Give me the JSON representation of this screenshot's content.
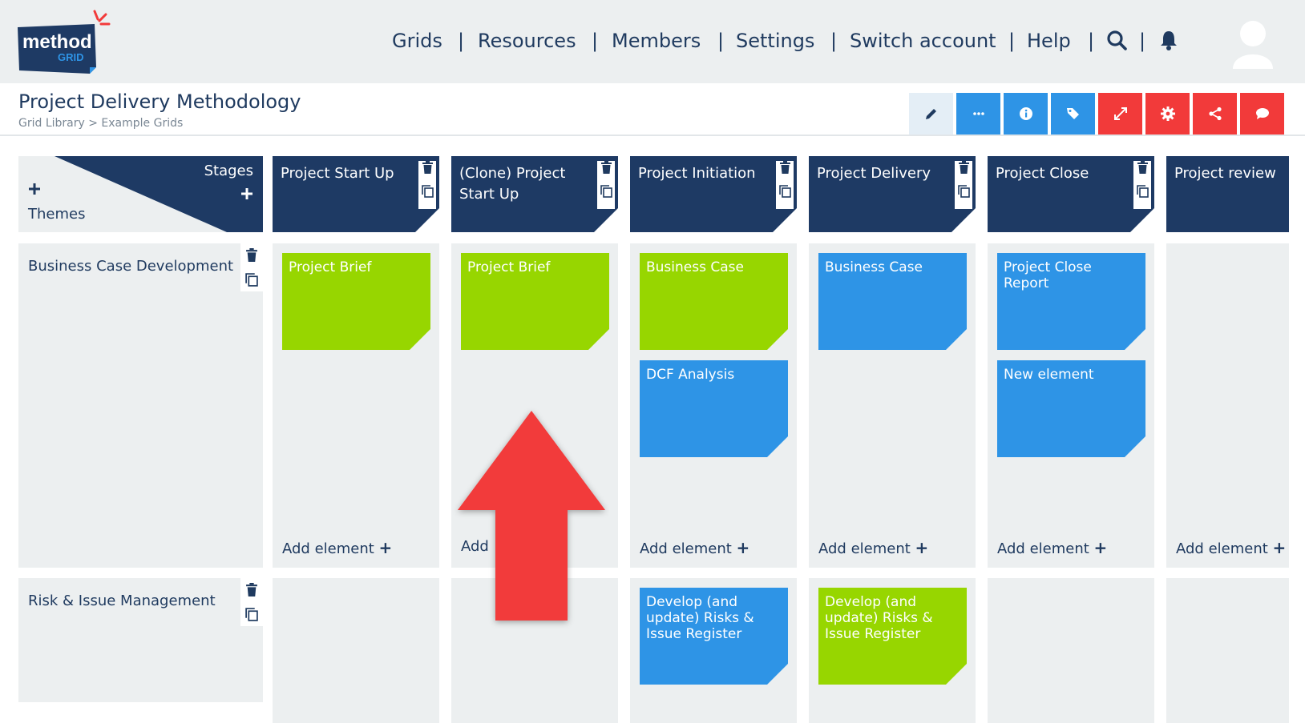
{
  "logo": {
    "word": "method",
    "sub": "GRID"
  },
  "nav": {
    "items": [
      "Grids",
      "Resources",
      "Members",
      "Settings",
      "Switch account",
      "Help"
    ],
    "separator": "|"
  },
  "header": {
    "title": "Project Delivery Methodology",
    "breadcrumb": "Grid Library > Example Grids"
  },
  "toolbar": {
    "buttons": [
      {
        "icon": "pencil-icon",
        "color": "#e4eef6"
      },
      {
        "icon": "more-icon",
        "color": "#2e94e6"
      },
      {
        "icon": "info-icon",
        "color": "#2e94e6"
      },
      {
        "icon": "tag-icon",
        "color": "#2e94e6"
      },
      {
        "icon": "expand-icon",
        "color": "#f23a3a"
      },
      {
        "icon": "gear-icon",
        "color": "#f23a3a"
      },
      {
        "icon": "share-icon",
        "color": "#f23a3a"
      },
      {
        "icon": "comment-icon",
        "color": "#f23a3a"
      }
    ]
  },
  "grid": {
    "corner": {
      "stages": "Stages",
      "themes": "Themes"
    },
    "stages": [
      "Project Start Up",
      "(Clone) Project Start Up",
      "Project Initiation",
      "Project Delivery",
      "Project Close",
      "Project review"
    ],
    "themes": [
      "Business Case Development",
      "Risk & Issue Management"
    ],
    "cards": {
      "r0c0": "Project Brief",
      "r0c1": "Project Brief",
      "r0c2a": "Business Case",
      "r0c2b": "DCF Analysis",
      "r0c3": "Business Case",
      "r0c4a": "Project Close Report",
      "r0c4b": "New element",
      "r1c2": "Develop (and update) Risks & Issue Register",
      "r1c3": "Develop (and update) Risks & Issue Register"
    },
    "add_element": "Add element",
    "add_partial": "Add"
  },
  "colors": {
    "navy": "#1e3a64",
    "green": "#97d600",
    "blue": "#2e94e6",
    "red": "#f23a3a",
    "cell": "#eceff0"
  }
}
